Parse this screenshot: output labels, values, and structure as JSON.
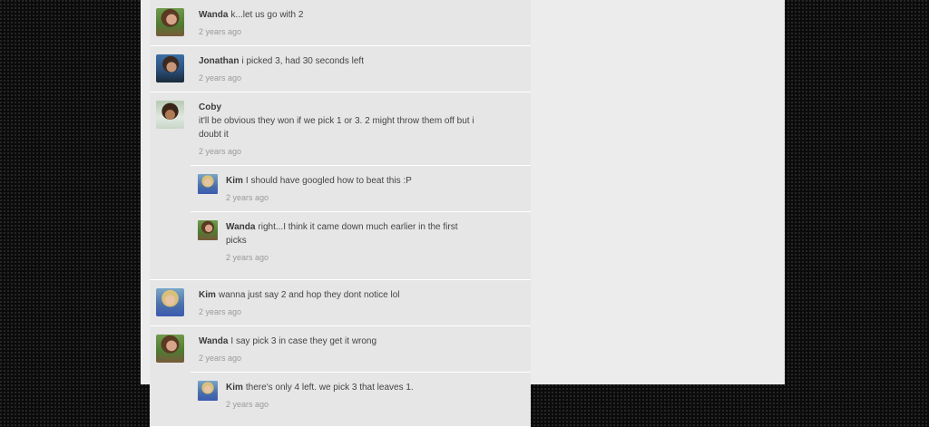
{
  "comments": [
    {
      "author": "Wanda",
      "text": "k...let us go with 2",
      "time": "2 years ago",
      "avatar": "wanda-avatar"
    },
    {
      "author": "Jonathan",
      "text": "i picked 3, had 30 seconds left",
      "time": "2 years ago",
      "avatar": "jonathan-avatar"
    },
    {
      "author": "Coby",
      "text": "it'll be obvious they won if we pick 1 or 3.  2 might throw them off but i doubt it",
      "time": "2 years ago",
      "avatar": "coby-avatar",
      "replies": [
        {
          "author": "Kim",
          "text": "I should have googled how to beat this :P",
          "time": "2 years ago",
          "avatar": "kim-avatar"
        },
        {
          "author": "Wanda",
          "text": "right...I think it came down much earlier in the first picks",
          "time": "2 years ago",
          "avatar": "wanda-avatar"
        }
      ]
    },
    {
      "author": "Kim",
      "text": "wanna just say 2 and hop they dont notice lol",
      "time": "2 years ago",
      "avatar": "kim-avatar"
    },
    {
      "author": "Wanda",
      "text": "I say pick 3 in case they get it wrong",
      "time": "2 years ago",
      "avatar": "wanda-avatar",
      "replies": [
        {
          "author": "Kim",
          "text": "there's only 4 left. we pick 3 that leaves 1.",
          "time": "2 years ago",
          "avatar": "kim-avatar"
        }
      ]
    }
  ]
}
